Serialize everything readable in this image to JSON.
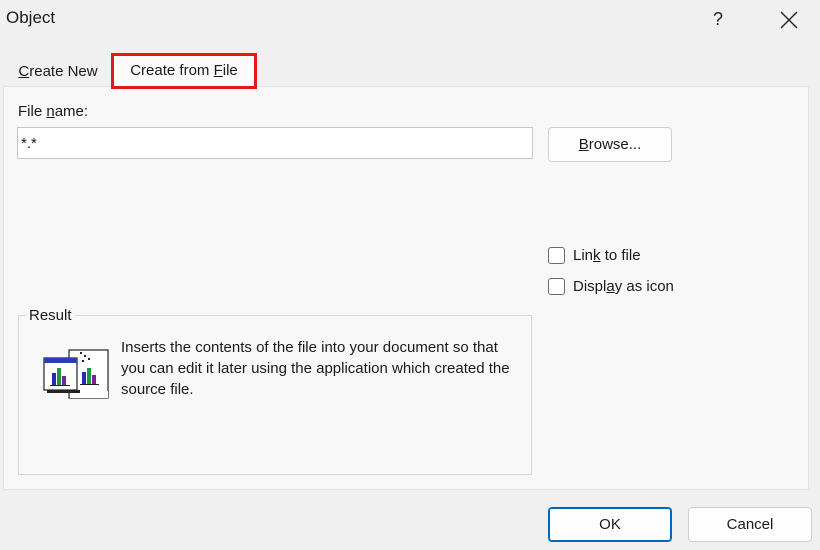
{
  "window": {
    "title": "Object",
    "help_label": "?"
  },
  "tabs": [
    {
      "label_pre": "",
      "accel": "C",
      "label_post": "reate New"
    },
    {
      "label_pre": "Create from ",
      "accel": "F",
      "label_post": "ile"
    }
  ],
  "file_name": {
    "label_pre": "File ",
    "accel": "n",
    "label_post": "ame:",
    "value": "*.*"
  },
  "browse": {
    "accel": "B",
    "label_post": "rowse..."
  },
  "link_to_file": {
    "label_pre": "Lin",
    "accel": "k",
    "label_post": " to file",
    "checked": false
  },
  "display_as_icon": {
    "label_pre": "Displ",
    "accel": "a",
    "label_post": "y as icon",
    "checked": false
  },
  "result": {
    "title": "Result",
    "text": "Inserts the contents of the file into your document so that you can edit it later using the application which created the source file."
  },
  "buttons": {
    "ok": "OK",
    "cancel": "Cancel"
  },
  "colors": {
    "highlight": "#e01a1a",
    "accent": "#0067c0"
  }
}
